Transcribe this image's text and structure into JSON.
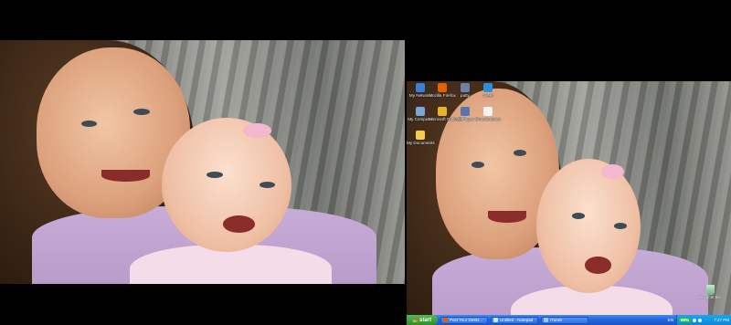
{
  "desktop": {
    "icons": [
      {
        "label": "My Network",
        "icon": "network-places-icon",
        "color": "#3a7fd6"
      },
      {
        "label": "Mozilla Firefox",
        "icon": "firefox-icon",
        "color": "#e66000"
      },
      {
        "label": "putty",
        "icon": "putty-icon",
        "color": "#6f7fa8"
      },
      {
        "label": "tweet",
        "icon": "tweet-icon",
        "color": "#2d8fd9"
      },
      {
        "label": "My Computer",
        "icon": "my-computer-icon",
        "color": "#7aa6d8"
      },
      {
        "label": "Microsoft Outlook",
        "icon": "outlook-icon",
        "color": "#e5b620"
      },
      {
        "label": "VMPlayer",
        "icon": "vmplayer-icon",
        "color": "#5874b3"
      },
      {
        "label": "ShowSolution",
        "icon": "document-icon",
        "color": "#f2f2f2"
      },
      {
        "label": "My Documents",
        "icon": "my-documents-icon",
        "color": "#f4cc4c"
      }
    ],
    "recycle_bin": {
      "label": "Recycle Bin",
      "icon": "recycle-bin-icon"
    }
  },
  "taskbar": {
    "start_label": "start",
    "tasks": [
      {
        "label": "Post Your Desktop Sc...",
        "icon": "firefox-icon",
        "color": "#e66000"
      },
      {
        "label": "Untitled - Notepad",
        "icon": "notepad-icon",
        "color": "#cfe3f7"
      },
      {
        "label": "iTunes",
        "icon": "itunes-icon",
        "color": "#9fc7f0"
      }
    ],
    "language": "EN",
    "battery_badge": "96%",
    "clock": "7:27 PM"
  },
  "colors": {
    "taskbar_blue": "#2568e0",
    "start_green": "#3aa43a",
    "tray_blue": "#0f86d6"
  }
}
